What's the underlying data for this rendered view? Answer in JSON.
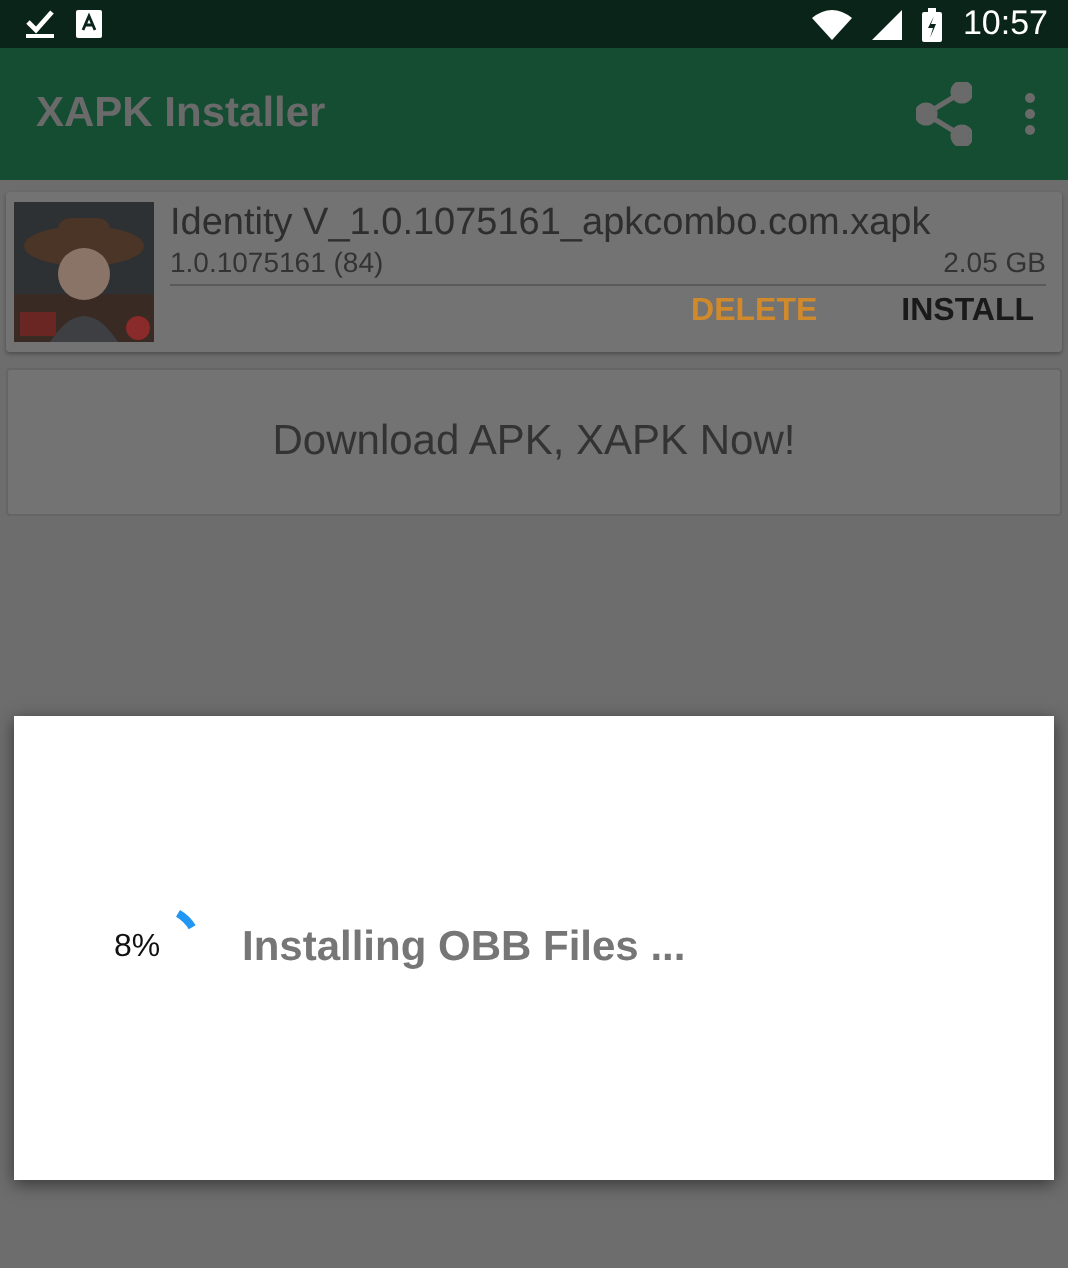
{
  "status_bar": {
    "time": "10:57"
  },
  "toolbar": {
    "title": "XAPK Installer"
  },
  "files": [
    {
      "name": "Identity V_1.0.1075161_apkcombo.com.xapk",
      "version": "1.0.1075161 (84)",
      "size": "2.05 GB",
      "actions": [
        "DELETE",
        "INSTALL"
      ]
    }
  ],
  "download_banner": {
    "label": "Download APK, XAPK Now!"
  },
  "dialog": {
    "progress": {
      "reading": "8%"
    },
    "message": "Installing OBB Files ..."
  }
}
